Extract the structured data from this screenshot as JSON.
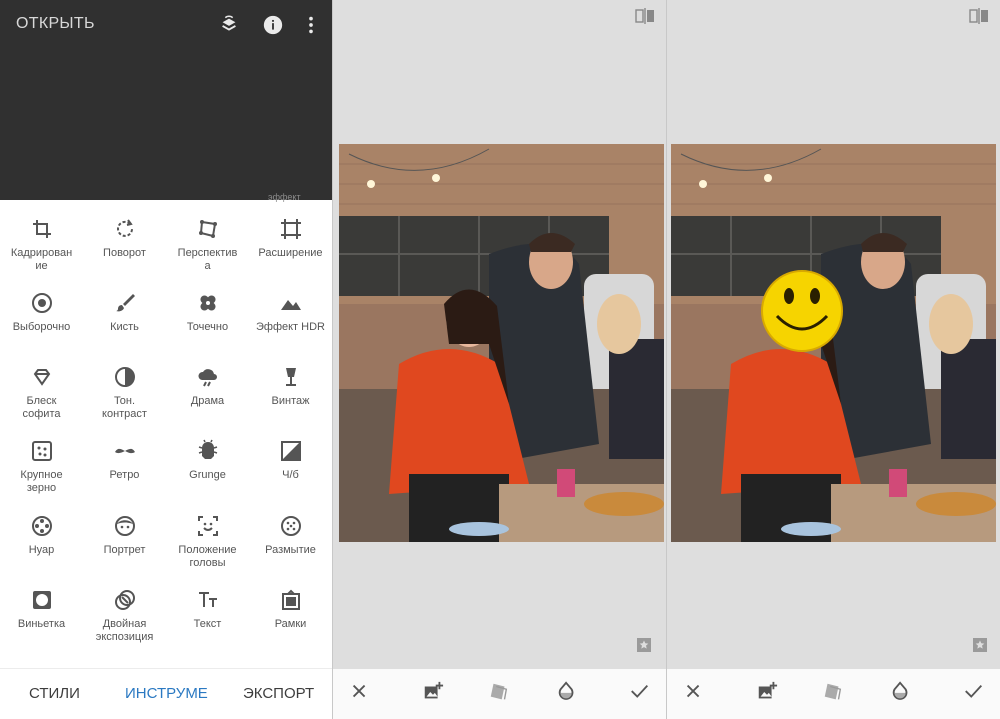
{
  "panel_tools": {
    "open_label": "ОТКРЫТЬ",
    "header_icons": [
      "layers-stack-icon",
      "info-icon",
      "more-vert-icon"
    ],
    "peek_text": "эффект",
    "tools": [
      {
        "label": "Кадрирован\nие",
        "icon": "crop-icon"
      },
      {
        "label": "Поворот",
        "icon": "rotate-icon"
      },
      {
        "label": "Перспектив\nа",
        "icon": "perspective-icon"
      },
      {
        "label": "Расширение",
        "icon": "expand-icon"
      },
      {
        "label": "Выборочно",
        "icon": "selective-icon"
      },
      {
        "label": "Кисть",
        "icon": "brush-icon"
      },
      {
        "label": "Точечно",
        "icon": "healing-icon"
      },
      {
        "label": "Эффект HDR",
        "icon": "hdr-icon"
      },
      {
        "label": "Блеск\nсофита",
        "icon": "glamour-glow-icon"
      },
      {
        "label": "Тон.\nконтраст",
        "icon": "tonal-contrast-icon"
      },
      {
        "label": "Драма",
        "icon": "drama-icon"
      },
      {
        "label": "Винтаж",
        "icon": "vintage-icon"
      },
      {
        "label": "Крупное\nзерно",
        "icon": "grainy-film-icon"
      },
      {
        "label": "Ретро",
        "icon": "retrolux-icon"
      },
      {
        "label": "Grunge",
        "icon": "grunge-icon"
      },
      {
        "label": "Ч/б",
        "icon": "black-white-icon"
      },
      {
        "label": "Нуар",
        "icon": "noir-icon"
      },
      {
        "label": "Портрет",
        "icon": "portrait-icon"
      },
      {
        "label": "Положение\nголовы",
        "icon": "head-pose-icon"
      },
      {
        "label": "Размытие",
        "icon": "lens-blur-icon"
      },
      {
        "label": "Виньетка",
        "icon": "vignette-icon"
      },
      {
        "label": "Двойная\nэкспозиция",
        "icon": "double-exposure-icon"
      },
      {
        "label": "Текст",
        "icon": "text-icon"
      },
      {
        "label": "Рамки",
        "icon": "frames-icon"
      }
    ],
    "nav": {
      "styles": "СТИЛИ",
      "tools": "ИНСТРУМЕ",
      "export": "ЭКСПОРТ"
    }
  },
  "editor_toolbar": {
    "buttons": [
      "close-icon",
      "add-image-icon",
      "layers-icon",
      "droplet-icon",
      "check-icon"
    ]
  },
  "colors": {
    "accent": "#2b79c2",
    "topbar_bg": "#303030",
    "workspace_bg": "#dedede"
  }
}
